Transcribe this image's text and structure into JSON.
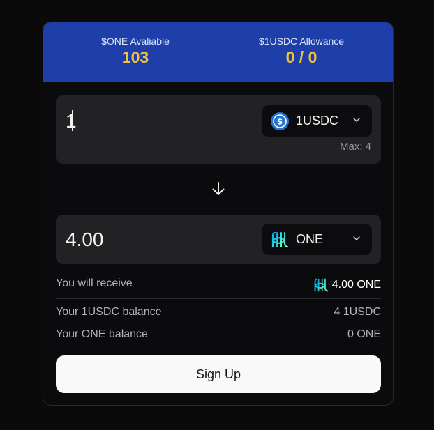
{
  "header": {
    "one_available_label": "$ONE Avaliable",
    "one_available_value": "103",
    "allowance_label": "$1USDC Allowance",
    "allowance_value": "0 / 0"
  },
  "from": {
    "amount": "1",
    "token": "1USDC",
    "token_icon": "usdc-icon",
    "max_label": "Max: 4"
  },
  "to": {
    "amount": "4.00",
    "token": "ONE",
    "token_icon": "harmony-one-icon"
  },
  "summary": {
    "receive_label": "You will receive",
    "receive_value": "4.00 ONE",
    "usdc_balance_label": "Your 1USDC balance",
    "usdc_balance_value": "4 1USDC",
    "one_balance_label": "Your ONE balance",
    "one_balance_value": "0 ONE"
  },
  "actions": {
    "signup_label": "Sign Up"
  },
  "colors": {
    "header_bg": "#1e3faa",
    "header_value": "#f5c33b",
    "page_bg": "#0a0a0b",
    "panel_bg": "#222224",
    "usdc_blue": "#2775ca",
    "one_teal": "#4fd2c9"
  }
}
